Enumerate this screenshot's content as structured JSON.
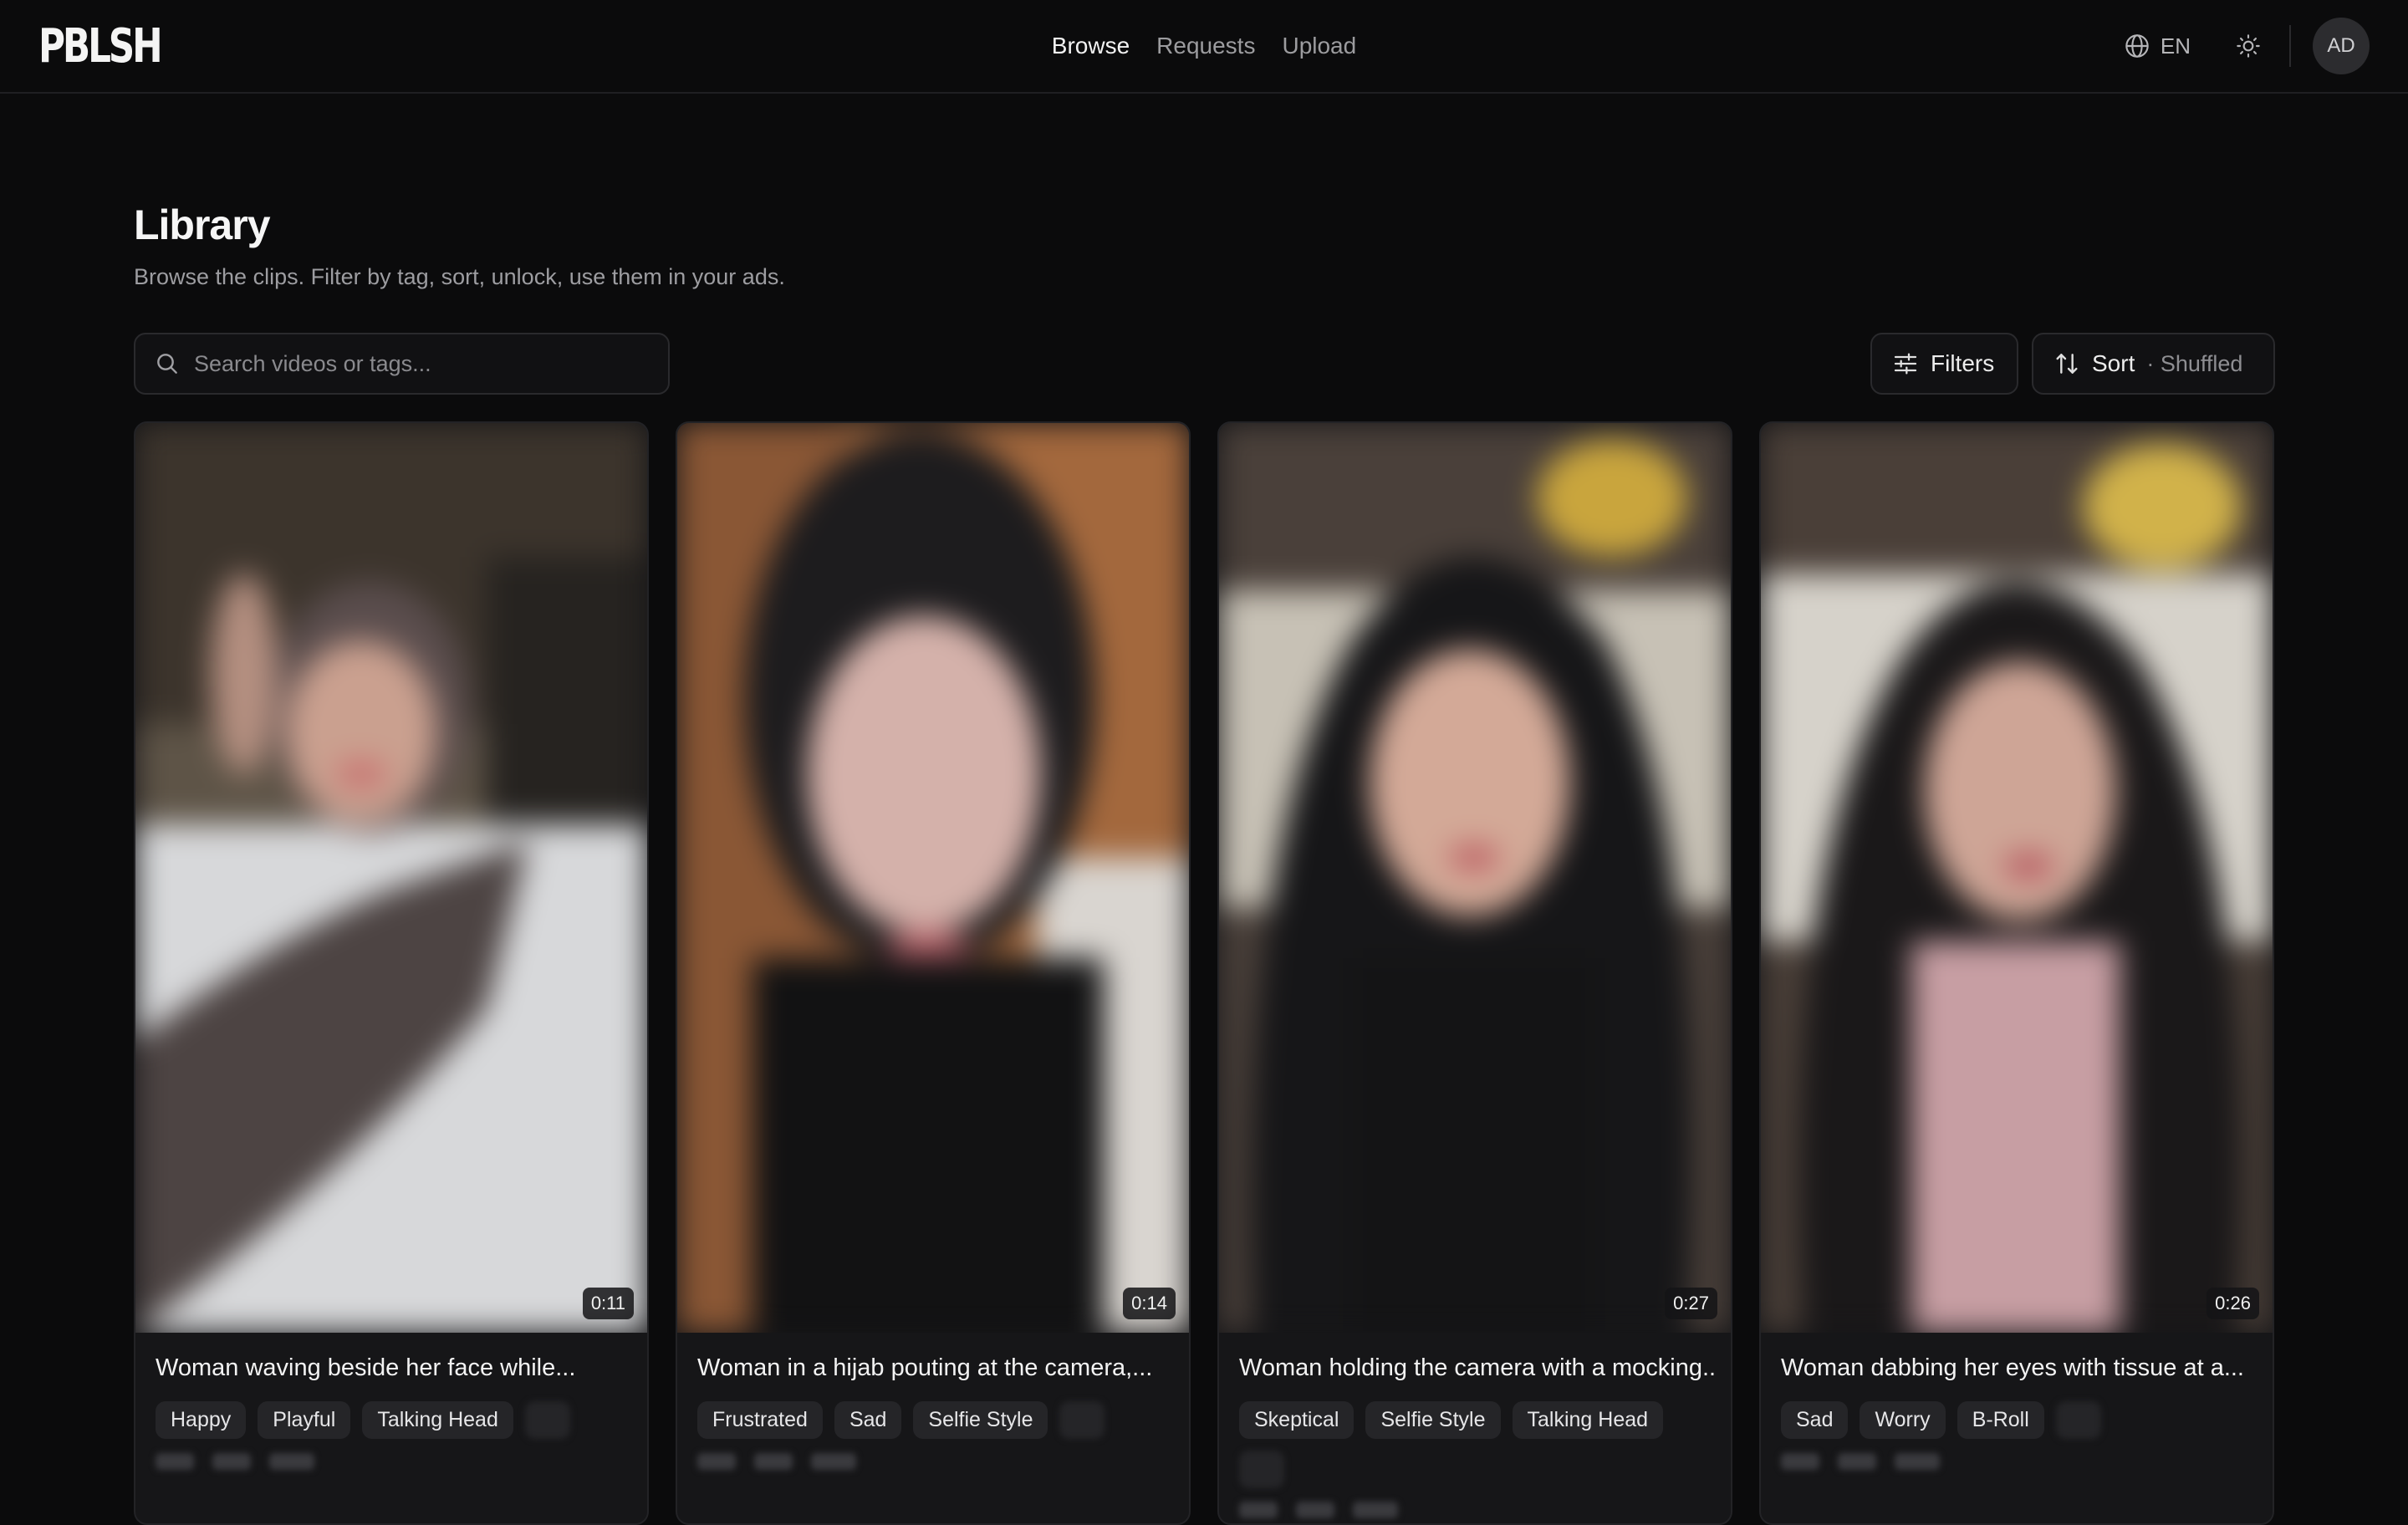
{
  "header": {
    "logo": "PBLSH",
    "nav": [
      {
        "label": "Browse",
        "active": true
      },
      {
        "label": "Requests",
        "active": false
      },
      {
        "label": "Upload",
        "active": false
      }
    ],
    "language": "EN",
    "avatar_initials": "AD",
    "icons": [
      "globe-icon",
      "sun-icon"
    ]
  },
  "page": {
    "title": "Library",
    "subtitle": "Browse the clips. Filter by tag, sort, unlock, use them in your ads."
  },
  "search": {
    "placeholder": "Search videos or tags..."
  },
  "toolbar": {
    "filters_label": "Filters",
    "sort_label": "Sort",
    "sort_value": "· Shuffled"
  },
  "cards": [
    {
      "duration": "0:11",
      "title": "Woman waving beside her face while...",
      "tags": [
        "Happy",
        "Playful",
        "Talking Head"
      ]
    },
    {
      "duration": "0:14",
      "title": "Woman in a hijab pouting at the camera,...",
      "tags": [
        "Frustrated",
        "Sad",
        "Selfie Style"
      ]
    },
    {
      "duration": "0:27",
      "title": "Woman holding the camera with a mocking...",
      "tags": [
        "Skeptical",
        "Selfie Style",
        "Talking Head"
      ]
    },
    {
      "duration": "0:26",
      "title": "Woman dabbing her eyes with tissue at a...",
      "tags": [
        "Sad",
        "Worry",
        "B-Roll"
      ]
    }
  ]
}
